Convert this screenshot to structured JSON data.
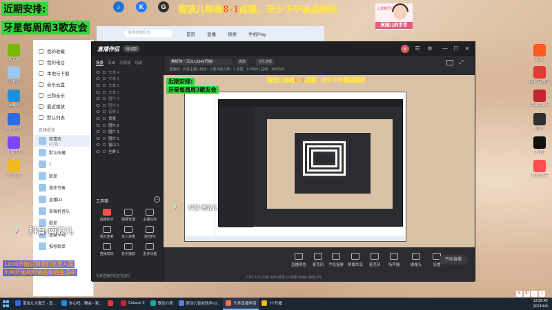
{
  "overlay": {
    "schedule_title": "近期安排:",
    "schedule_line": "牙星每周周3歌友会",
    "banner": "南波儿每晚8-1点播，牙少下午俩点娱乐",
    "tiktok_label": "抖音:南波儿",
    "avatar_caption": "上波弗灵儿",
    "avatar_name": "屌婉儿的手手",
    "promo_line_1": "13:00开始后到我们这里人面",
    "promo_line_2": "3:00开始到时候在你的生活中"
  },
  "desktop_icons": [
    {
      "label": "NVIDIA",
      "color": "#76b900"
    },
    {
      "label": "回收站",
      "color": "#9cc7ee"
    },
    {
      "label": "Edge",
      "color": "#1e90d8"
    },
    {
      "label": "酷狗音乐",
      "color": "#2d6ae3"
    },
    {
      "label": "直播伴侣",
      "color": "#7a46ff"
    },
    {
      "label": "YY语音",
      "color": "#f2b81f"
    },
    {
      "label": "快手",
      "color": "#ff5a20"
    },
    {
      "label": "网易云音乐",
      "color": "#e53935"
    },
    {
      "label": "Cubase 5",
      "color": "#c1272d"
    },
    {
      "label": "OBS",
      "color": "#303030"
    },
    {
      "label": "抖音",
      "color": "#111111"
    },
    {
      "label": "直播助手",
      "color": "#ff4f4f"
    }
  ],
  "top_icons": [
    {
      "label": "K",
      "color": "#2979ff"
    },
    {
      "label": "G",
      "color": "#303030"
    },
    {
      "label": "♪",
      "color": "#1976d2"
    }
  ],
  "music_app": {
    "nav": [
      "我的收藏",
      "我的电台",
      "本地与下载",
      "音乐云盘",
      "已购音乐",
      "最近播放",
      "默认列表"
    ],
    "section_title": "自建歌单",
    "playlists": [
      {
        "label": "我喜欢",
        "sub": "427首",
        "active": true
      },
      {
        "label": "默认收藏",
        "sub": "",
        "active": false
      },
      {
        "label": "1",
        "sub": "",
        "active": false
      },
      {
        "label": "歌单",
        "sub": "",
        "active": false
      },
      {
        "label": "慢炸节奏",
        "sub": "",
        "active": false
      },
      {
        "label": "直播DJ",
        "sub": "",
        "active": false
      },
      {
        "label": "草莓机音乐",
        "sub": "",
        "active": false
      },
      {
        "label": "歌单",
        "sub": "",
        "active": false
      },
      {
        "label": "直播专用",
        "sub": "",
        "active": false
      },
      {
        "label": "推荐歌单",
        "sub": "",
        "active": false
      }
    ],
    "top_tabs": [
      "首页",
      "直播",
      "探索",
      "手机Play"
    ],
    "search_placeholder": "搜索你想听的"
  },
  "stream_app": {
    "logo": "直播伴侣",
    "version": "测试版",
    "scene_tabs": [
      "场景",
      "双击",
      "可添加",
      "场景"
    ],
    "sources": [
      "文本 4",
      "文本 3",
      "文本 2",
      "文本 1",
      "图片 4",
      "图片 5",
      "音频 1",
      "背景",
      "图片 2",
      "图片 3",
      "图片 1",
      "窗口 1",
      "全屏 1"
    ],
    "tools_title": "工具箱",
    "tools": [
      {
        "label": "直播助手",
        "hot": true
      },
      {
        "label": "弹幕管理",
        "hot": false
      },
      {
        "label": "主播任务",
        "hot": false
      },
      {
        "label": "观众连麦",
        "hot": false
      },
      {
        "label": "多人连麦",
        "hot": false
      },
      {
        "label": "连线PK",
        "hot": false
      },
      {
        "label": "直播加热",
        "hot": false
      },
      {
        "label": "音乐播放",
        "hot": false
      },
      {
        "label": "更多功能",
        "hot": false
      }
    ],
    "title_value": "美好的一天从12345开始！",
    "tag_1": "修改",
    "tag_2": "分区选择",
    "room_info": "直播间：抖音主播   | 粉丝：3    观众团人数：1    点赞：123455  |  在线：1601592",
    "bottom_buttons": [
      "直播预告",
      "麦克风",
      "手机投屏",
      "屏幕共享",
      "麦克风",
      "扬声器",
      "摄像头",
      "设置"
    ],
    "start_label": "开始直播",
    "stats": "CPU 11%   内存 44%   帧率 60   码率 0kbps   丢帧 0%",
    "status": "头条直播伴侣正在运行"
  },
  "taskbar": {
    "items": [
      {
        "label": "南波儿大魔王 - 直...",
        "color": "#2d6ae3",
        "active": false
      },
      {
        "label": "你心吗，舞会 - 家...",
        "color": "#1e90d8",
        "active": false
      },
      {
        "label": "",
        "color": "#e53935",
        "active": false
      },
      {
        "label": "Cubase 5",
        "color": "#c1272d",
        "active": false
      },
      {
        "label": "歌动力场",
        "color": "#26a69a",
        "active": false
      },
      {
        "label": "原动力音效软件V2...",
        "color": "#5b7fd6",
        "active": false
      },
      {
        "label": "头条直播伴侣",
        "color": "#ff7043",
        "active": true
      },
      {
        "label": "YY开播",
        "color": "#f2b81f",
        "active": false
      }
    ],
    "time": "13:58:42",
    "date": "2021/6/4"
  }
}
